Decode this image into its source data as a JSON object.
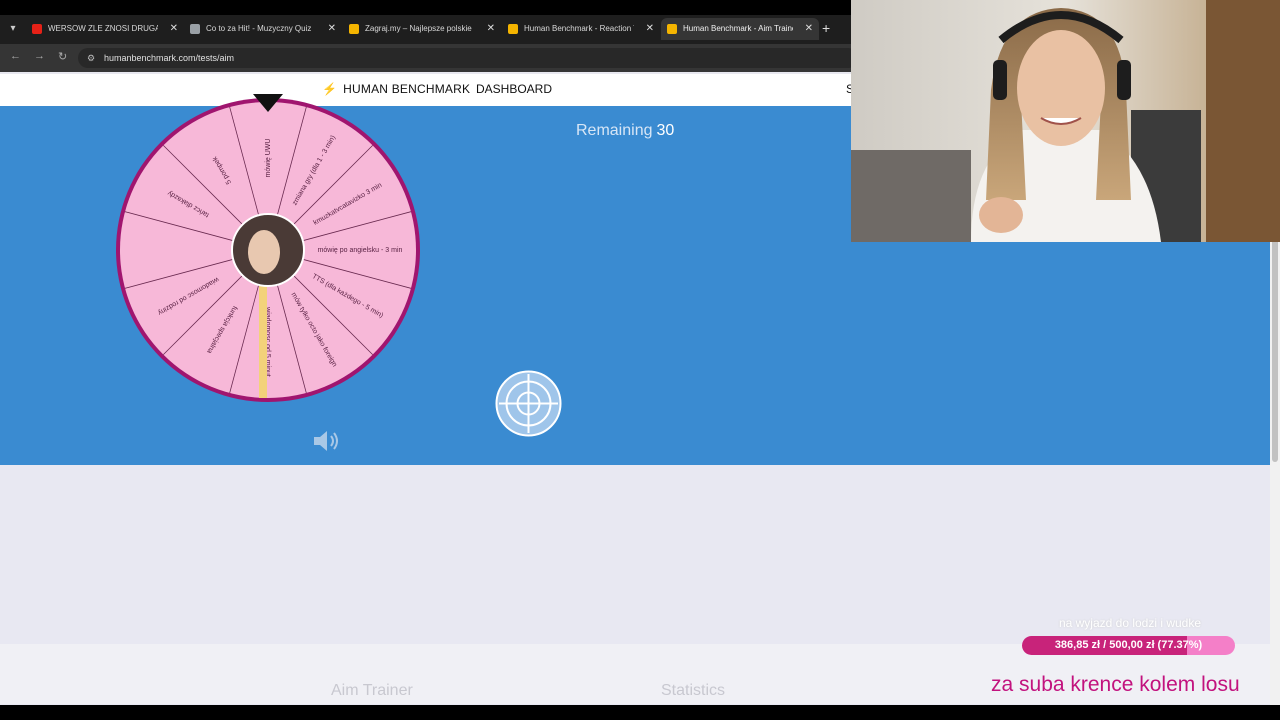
{
  "browser": {
    "tabs": [
      {
        "title": "WERSOW ZLE ZNOSI DRUGA C",
        "favicon_color": "#e62117",
        "active": false
      },
      {
        "title": "Co to za Hit! - Muzyczny Quiz",
        "favicon_color": "#9aa0a6",
        "active": false
      },
      {
        "title": "Zagraj.my – Najlepsze polskie",
        "favicon_color": "#f4b400",
        "active": false
      },
      {
        "title": "Human Benchmark - Reaction T",
        "favicon_color": "#f4b400",
        "active": false
      },
      {
        "title": "Human Benchmark - Aim Traine",
        "favicon_color": "#f4b400",
        "active": true
      }
    ],
    "url": "humanbenchmark.com/tests/aim"
  },
  "site": {
    "brand": "HUMAN BENCHMARK",
    "nav_dashboard": "DASHBOARD",
    "nav_right_partial": "S",
    "remaining_label": "Remaining",
    "remaining_value": "30",
    "card_titles": [
      "Aim Trainer",
      "Statistics"
    ]
  },
  "wheel": {
    "segments": [
      "zmiana gry (dla 1 - 3 min)",
      "kmuzkatvcatavizko 3 min",
      "mówię po angielsku - 3 min",
      "TTS (dla każdego - 5 min)",
      "mów tylko octo jako foreign",
      "wiadomosc od 5 minut",
      "funkcja specjalna",
      "wiadomosc od rodziny",
      "",
      "tańcz dlakazdy",
      "5 pompek",
      "mówię UWU"
    ],
    "colors": {
      "fill": "#f7b8d8",
      "rim": "#a0156f",
      "highlight": "#f3d27a"
    }
  },
  "overlay": {
    "goal_title": "na wyjazd do lodzi i wudke",
    "goal_text": "386,85 zł / 500,00 zł (77.37%)",
    "goal_fraction": 0.7737,
    "ticker": "za suba krence kolem losu"
  },
  "colors": {
    "test_bg": "#3a8bd1",
    "goal_fill": "#c8237a",
    "ticker": "#c2127e"
  }
}
